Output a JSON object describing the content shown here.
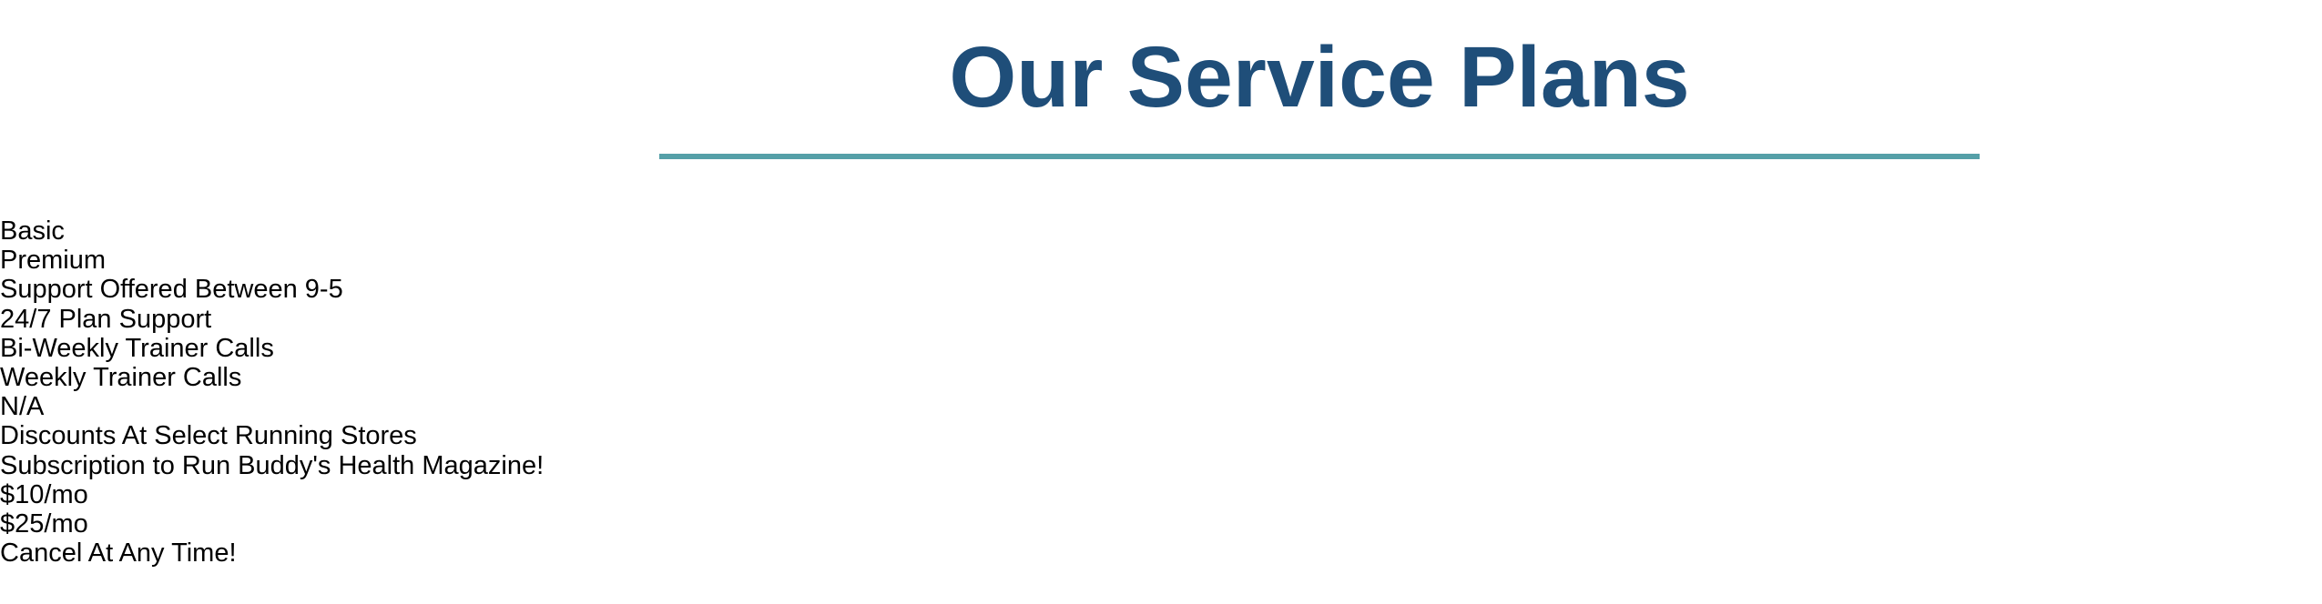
{
  "header": {
    "title": "Our Service Plans"
  },
  "colors": {
    "title": "#1f4e79",
    "rule": "#55a0a8",
    "text": "#000000",
    "background": "#ffffff"
  },
  "plans": {
    "items": [
      "Basic",
      "Premium",
      "Support Offered Between 9-5",
      "24/7 Plan Support",
      "Bi-Weekly Trainer Calls",
      "Weekly Trainer Calls",
      "N/A",
      "Discounts At Select Running Stores",
      "Subscription to Run Buddy's Health Magazine!",
      "$10/mo",
      "$25/mo",
      "Cancel At Any Time!"
    ]
  }
}
